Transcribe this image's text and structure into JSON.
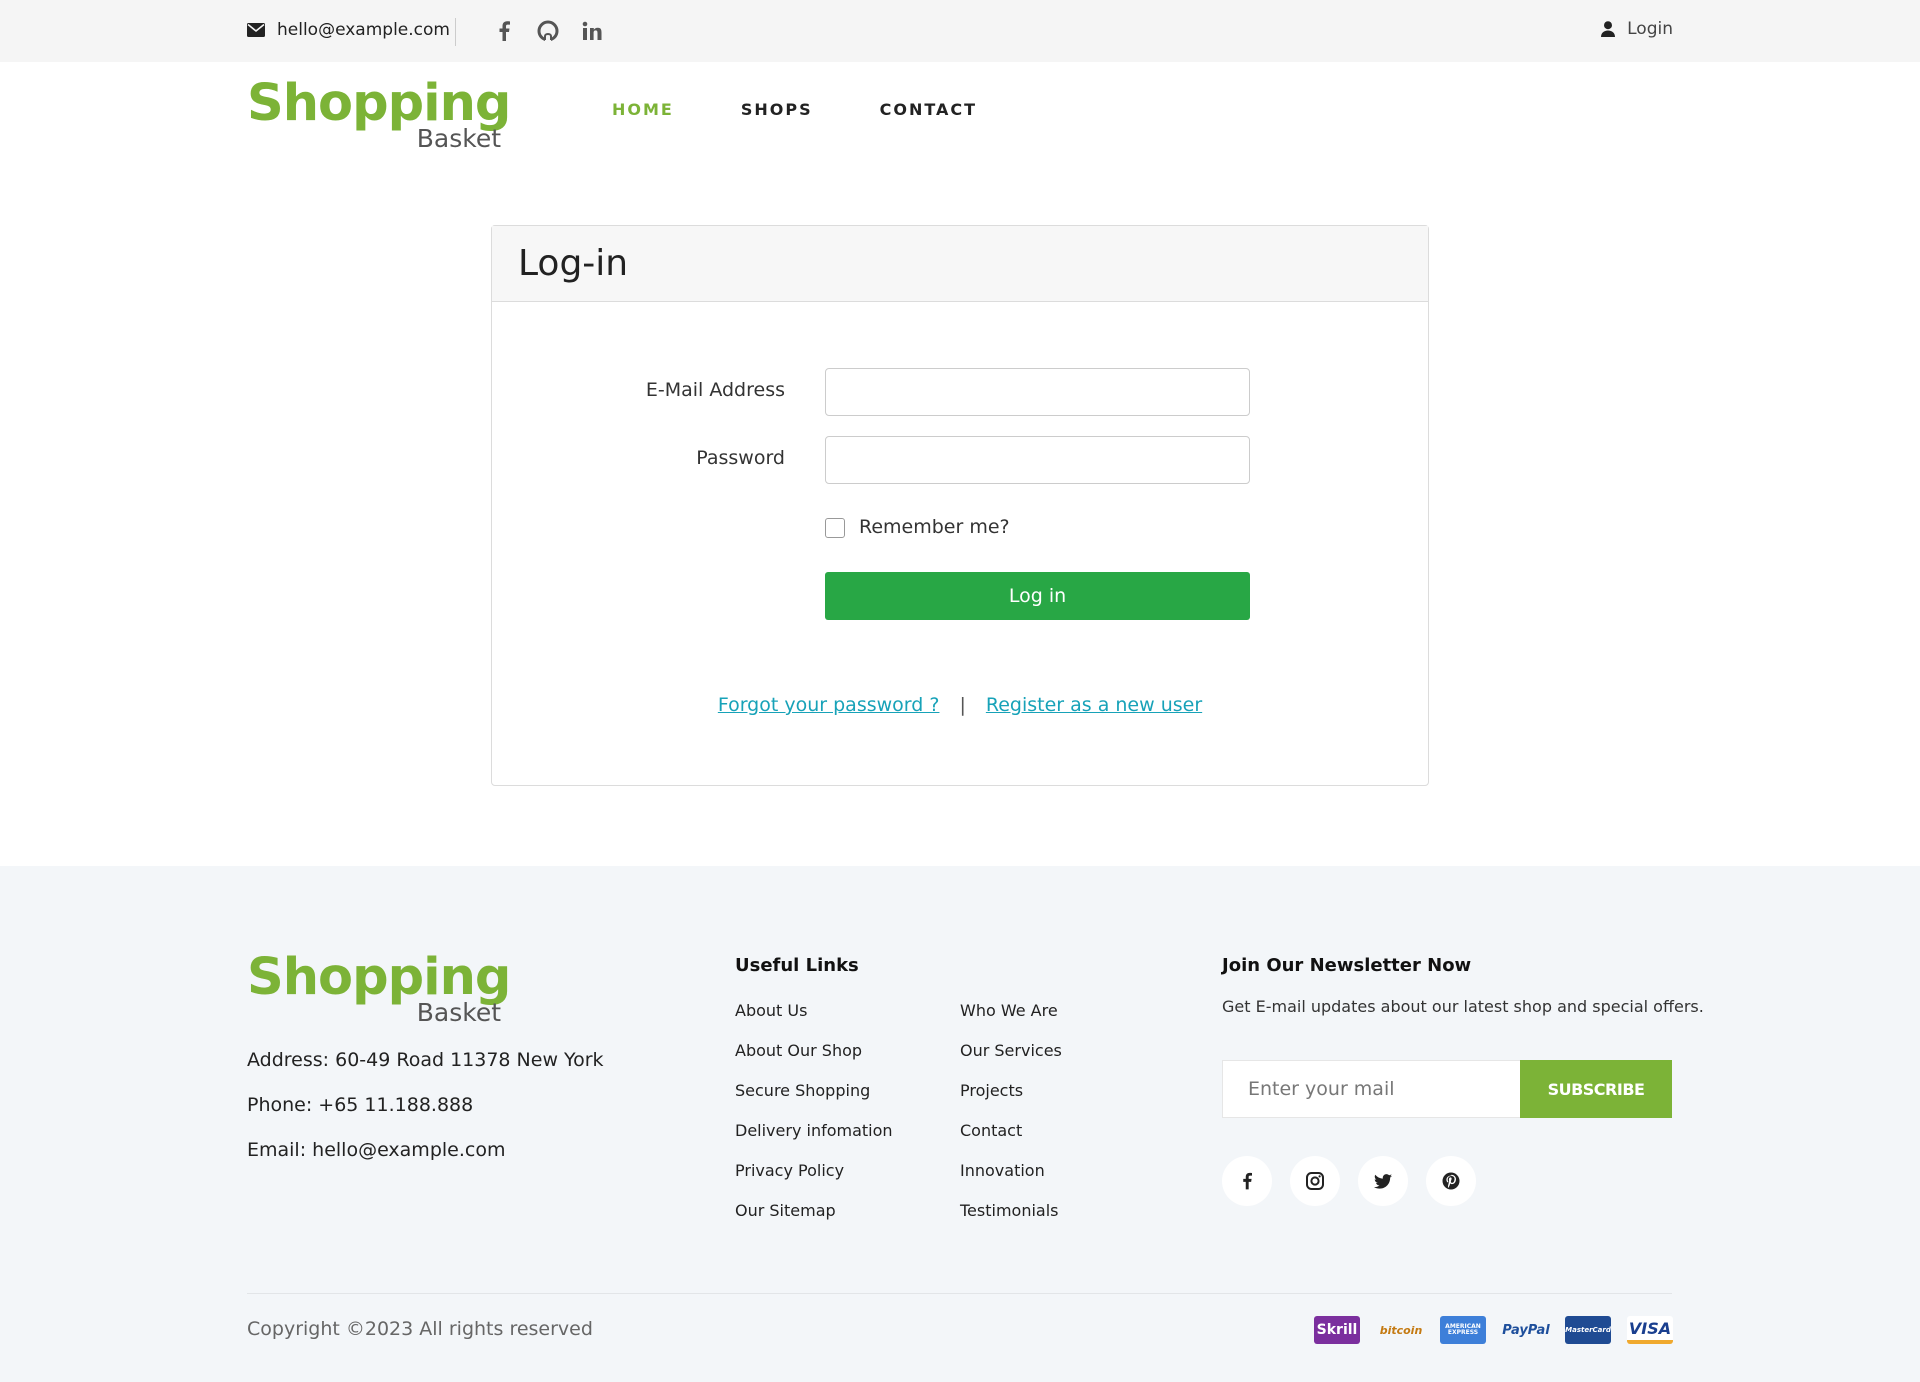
{
  "topbar": {
    "email": "hello@example.com",
    "social_icons": [
      "facebook-icon",
      "github-icon",
      "linkedin-icon"
    ],
    "login_label": "Login"
  },
  "brand": {
    "name_big": "Shopping",
    "name_small": "Basket",
    "color": "#7cb337"
  },
  "nav": {
    "items": [
      {
        "label": "HOME",
        "active": true
      },
      {
        "label": "SHOPS",
        "active": false
      },
      {
        "label": "CONTACT",
        "active": false
      }
    ]
  },
  "login_form": {
    "title": "Log-in",
    "email_label": "E-Mail Address",
    "email_value": "",
    "password_label": "Password",
    "password_value": "",
    "remember_label": "Remember me?",
    "remember_checked": false,
    "submit_label": "Log in",
    "forgot_link": "Forgot your password ?",
    "separator": "|",
    "register_link": "Register as a new user",
    "button_color": "#28a745",
    "link_color": "#17a2b8"
  },
  "footer": {
    "address": "Address: 60-49 Road 11378 New York",
    "phone": "Phone: +65 11.188.888",
    "email": "Email: hello@example.com",
    "useful_links_title": "Useful Links",
    "links_col1": [
      "About Us",
      "About Our Shop",
      "Secure Shopping",
      "Delivery infomation",
      "Privacy Policy",
      "Our Sitemap"
    ],
    "links_col2": [
      "Who We Are",
      "Our Services",
      "Projects",
      "Contact",
      "Innovation",
      "Testimonials"
    ],
    "newsletter_title": "Join Our Newsletter Now",
    "newsletter_desc": "Get E-mail updates about our latest shop and special offers.",
    "newsletter_placeholder": "Enter your mail",
    "subscribe_label": "SUBSCRIBE",
    "social_icons": [
      "facebook-icon",
      "instagram-icon",
      "twitter-icon",
      "pinterest-icon"
    ],
    "copyright": "Copyright ©2023 All rights reserved",
    "payments": [
      {
        "label": "Skrill",
        "bg": "#7b2f9e",
        "fg": "#ffffff"
      },
      {
        "label": "bitcoin",
        "bg": "#f3f6f9",
        "fg": "#c47a12"
      },
      {
        "label": "AMERICAN EXPRESS",
        "bg": "#3d7fd9",
        "fg": "#ffffff"
      },
      {
        "label": "PayPal",
        "bg": "#f3f6f9",
        "fg": "#1e4f9c"
      },
      {
        "label": "MasterCard",
        "bg": "#1f4b93",
        "fg": "#ffffff"
      },
      {
        "label": "VISA",
        "bg": "#ffffff",
        "fg": "#1a3f8f"
      }
    ]
  }
}
